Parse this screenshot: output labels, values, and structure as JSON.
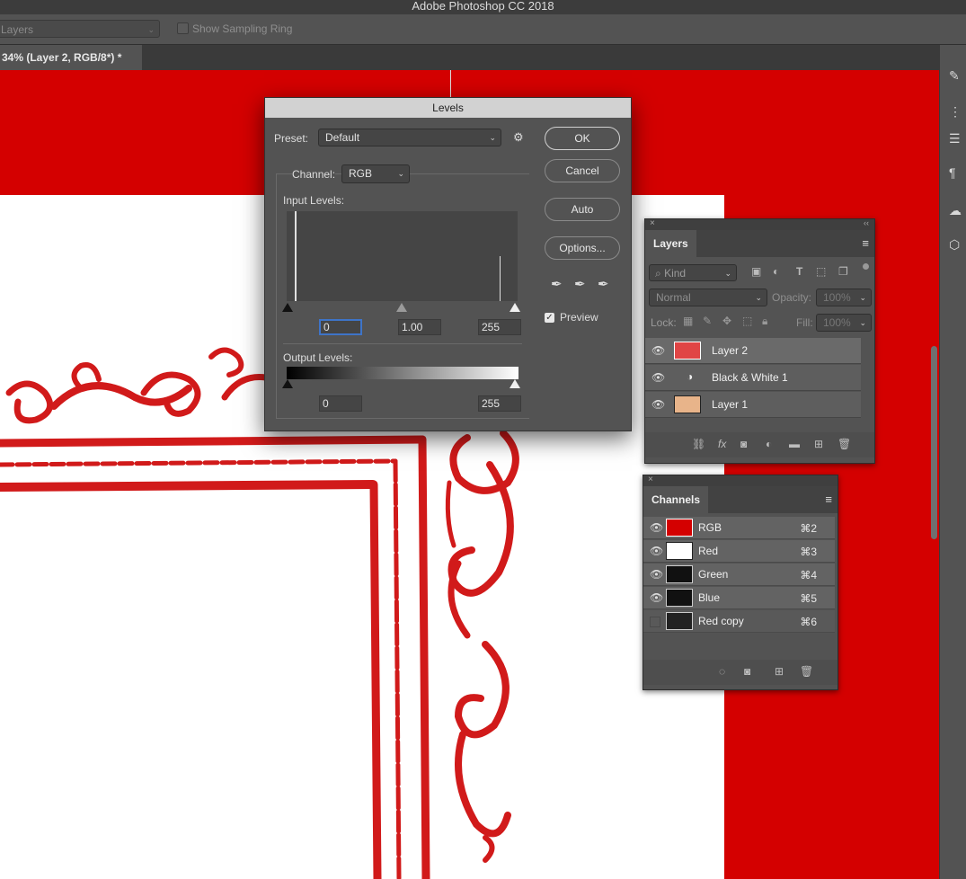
{
  "window": {
    "title": "Adobe Photoshop CC 2018"
  },
  "options_bar": {
    "sample_select": "Layers",
    "sampling_ring_label": "Show Sampling Ring"
  },
  "document": {
    "tab_label": "34% (Layer 2, RGB/8*) *"
  },
  "levels": {
    "title": "Levels",
    "preset_label": "Preset:",
    "preset_value": "Default",
    "channel_label": "Channel:",
    "channel_value": "RGB",
    "input_levels_label": "Input Levels:",
    "input_black": "0",
    "input_gamma": "1.00",
    "input_white": "255",
    "output_levels_label": "Output Levels:",
    "output_black": "0",
    "output_white": "255",
    "ok_label": "OK",
    "cancel_label": "Cancel",
    "auto_label": "Auto",
    "options_label": "Options...",
    "preview_label": "Preview",
    "preview_checked": true
  },
  "layers_panel": {
    "tab_label": "Layers",
    "filter_kind": "Kind",
    "blend_mode": "Normal",
    "opacity_label": "Opacity:",
    "opacity_value": "100%",
    "lock_label": "Lock:",
    "fill_label": "Fill:",
    "fill_value": "100%",
    "layers": [
      {
        "name": "Layer 2"
      },
      {
        "name": "Black & White 1"
      },
      {
        "name": "Layer 1"
      }
    ]
  },
  "channels_panel": {
    "tab_label": "Channels",
    "channels": [
      {
        "name": "RGB",
        "shortcut": "⌘2"
      },
      {
        "name": "Red",
        "shortcut": "⌘3"
      },
      {
        "name": "Green",
        "shortcut": "⌘4"
      },
      {
        "name": "Blue",
        "shortcut": "⌘5"
      },
      {
        "name": "Red copy",
        "shortcut": "⌘6"
      }
    ]
  },
  "colors": {
    "canvas_red": "#d40000",
    "border_red": "#d11a1a",
    "focus_blue": "#3e74c8"
  }
}
